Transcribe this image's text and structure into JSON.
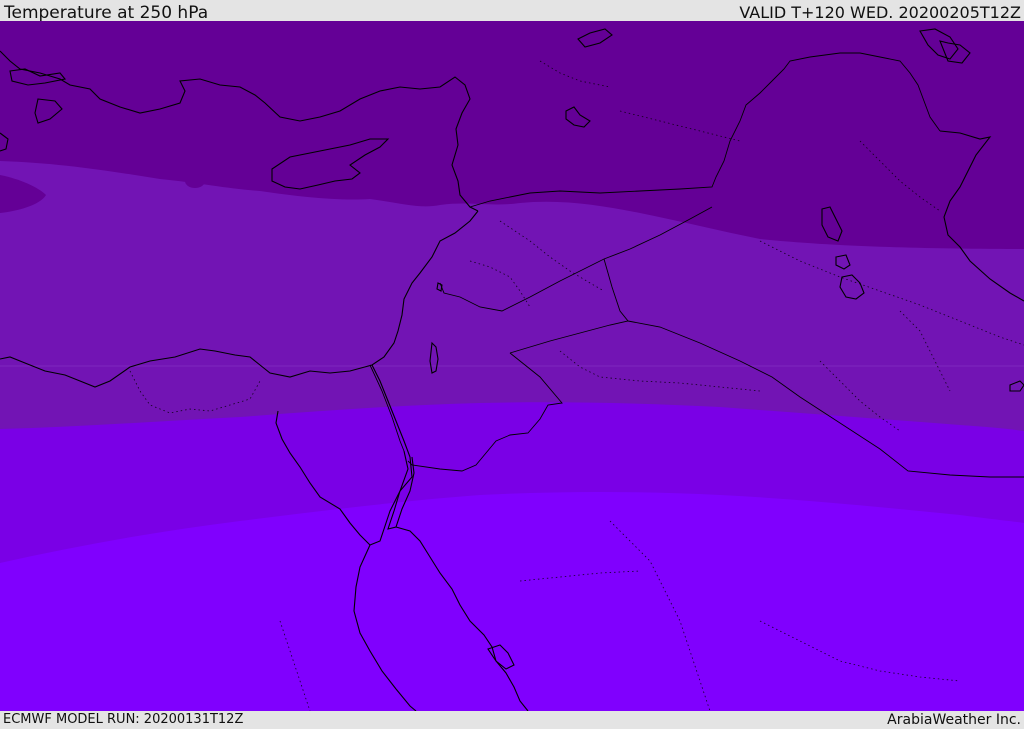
{
  "header": {
    "title": "Temperature at 250 hPa",
    "valid_time": "VALID T+120 WED. 20200205T12Z"
  },
  "footer": {
    "model_run": "ECMWF MODEL RUN: 20200131T12Z",
    "credit": "ArabiaWeather Inc."
  },
  "map": {
    "field": "temperature",
    "level": "250 hPa",
    "region": "Eastern Mediterranean / Middle East",
    "temperature_bands": [
      {
        "name": "band-coldest",
        "color": "#640096"
      },
      {
        "name": "band-cold",
        "color": "#7214b4"
      },
      {
        "name": "band-mid",
        "color": "#7a00e6"
      },
      {
        "name": "band-warm",
        "color": "#8000fe"
      }
    ],
    "coastline_color": "#000000",
    "border_style": "dotted"
  }
}
